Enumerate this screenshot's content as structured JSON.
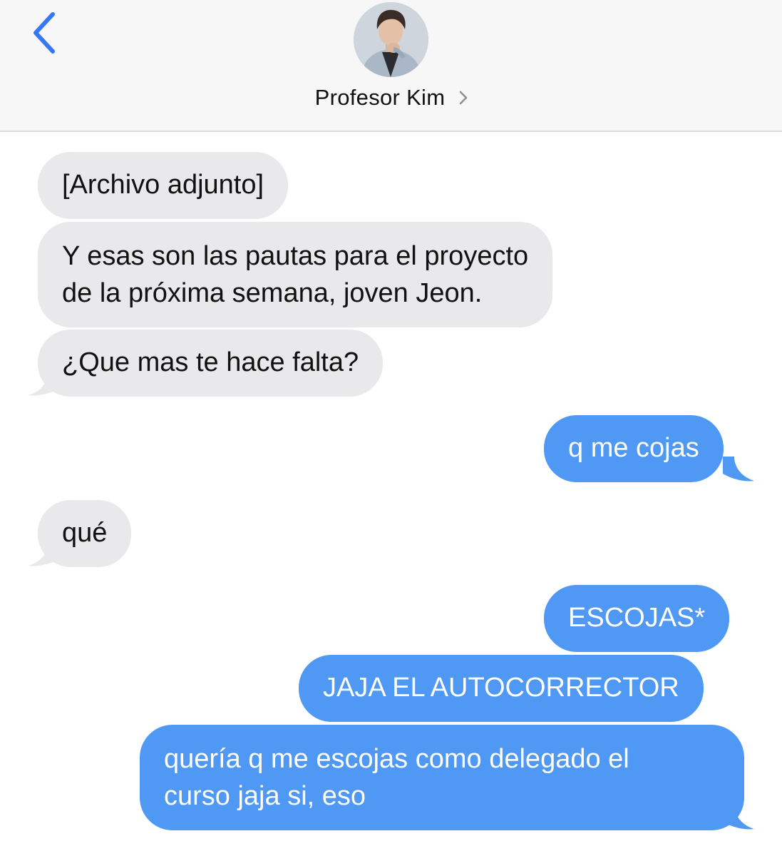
{
  "header": {
    "contact_name": "Profesor Kim",
    "back_icon": "chevron-left-icon",
    "details_icon": "chevron-right-icon"
  },
  "colors": {
    "incoming_bubble": "#e9e9eb",
    "outgoing_bubble": "#4f98f4",
    "back_accent": "#3478f6",
    "header_background": "#f7f7f7"
  },
  "messages": [
    {
      "direction": "incoming",
      "lines": [
        "[Archivo adjunto]"
      ]
    },
    {
      "direction": "incoming",
      "lines": [
        "Y esas son las pautas para el proyecto",
        "de la próxima semana, joven Jeon."
      ]
    },
    {
      "direction": "incoming",
      "lines": [
        "¿Que mas te hace falta?"
      ]
    },
    {
      "direction": "outgoing",
      "lines": [
        "q me cojas"
      ]
    },
    {
      "direction": "incoming",
      "lines": [
        "qué"
      ]
    },
    {
      "direction": "outgoing",
      "lines": [
        "ESCOJAS*"
      ]
    },
    {
      "direction": "outgoing",
      "lines": [
        "JAJA EL AUTOCORRECTOR"
      ]
    },
    {
      "direction": "outgoing",
      "lines": [
        "quería q me escojas como delegado el",
        "curso jaja si, eso"
      ]
    }
  ]
}
